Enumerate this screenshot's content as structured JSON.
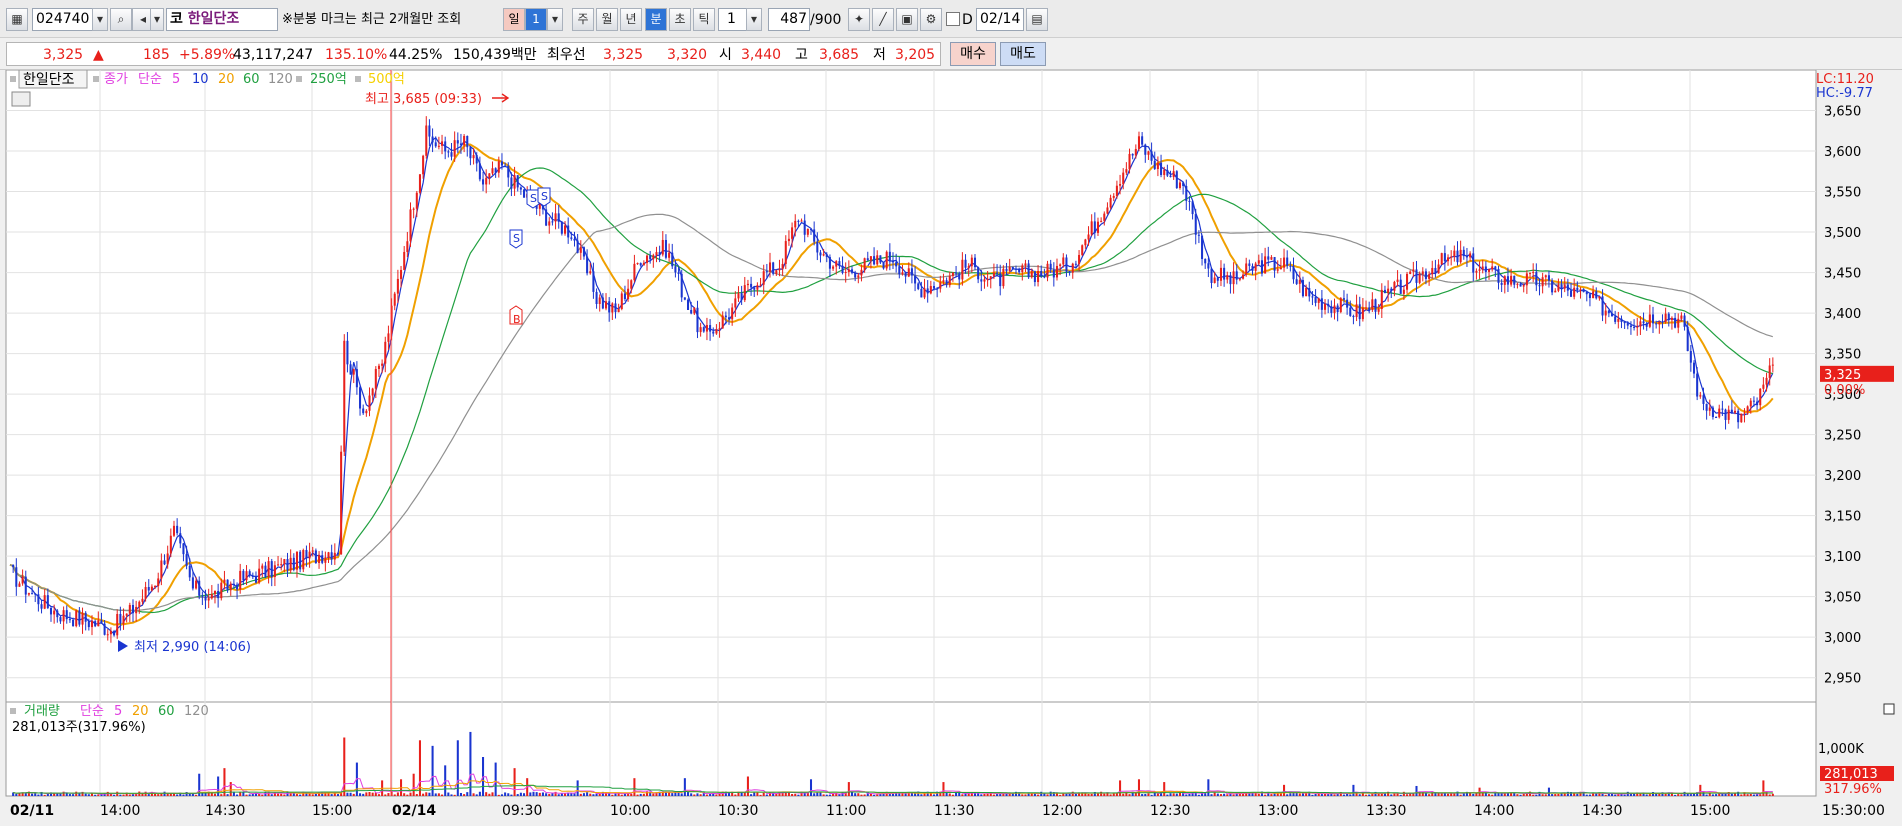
{
  "toolbar": {
    "code": "024740",
    "market_tag": "코",
    "name": "한일단조",
    "notice": "※분봉 마크는 최근 2개월만 조회",
    "period_tabs": [
      {
        "label": "일",
        "active": false
      },
      {
        "label": "주",
        "active": false
      },
      {
        "label": "월",
        "active": false
      },
      {
        "label": "년",
        "active": false
      },
      {
        "label": "분",
        "active": true
      },
      {
        "label": "초",
        "active": false
      },
      {
        "label": "틱",
        "active": false
      }
    ],
    "day_count": "1",
    "interval": "1",
    "count": "487",
    "count_max": "/900",
    "date_flag": "D",
    "date": "02/14"
  },
  "quote": {
    "price": "3,325",
    "change_arrow": "▲",
    "change": "185",
    "change_pct": "+5.89%",
    "volume": "43,117,247",
    "volume_ratio": "135.10%",
    "turnover_pct": "44.25%",
    "amount": "150,439백만",
    "best_label": "최우선",
    "best_ask": "3,325",
    "best_bid": "3,320",
    "open_label": "시",
    "open": "3,440",
    "high_label": "고",
    "high": "3,685",
    "low_label": "저",
    "low": "3,205",
    "buy_label": "매수",
    "sell_label": "매도"
  },
  "colors": {
    "up": "#e8201b",
    "down": "#1a35d0",
    "ma5": "#1a35d0",
    "ma10": "#e040e0",
    "ma20": "#f0a000",
    "ma60": "#20a040",
    "ma120": "#909090",
    "vol5": "#e040e0",
    "vol20": "#f0a000",
    "vol60": "#20a040"
  },
  "chart_data": {
    "type": "candlestick",
    "title": "",
    "legend": {
      "name": "한일단조",
      "field": "종가",
      "method": "단순",
      "periods": [
        "5",
        "10",
        "20",
        "60",
        "120"
      ],
      "amounts": [
        "250억",
        "500억"
      ]
    },
    "y_ticks": [
      "3,650",
      "3,600",
      "3,550",
      "3,500",
      "3,450",
      "3,400",
      "3,350",
      "3,300",
      "3,250",
      "3,200",
      "3,150",
      "3,100",
      "3,050",
      "3,000",
      "2,950"
    ],
    "ylim": [
      2920,
      3700
    ],
    "x_ticks": [
      "02/11",
      "14:00",
      "14:30",
      "15:00",
      "02/14",
      "09:30",
      "10:00",
      "10:30",
      "11:00",
      "11:30",
      "12:00",
      "12:30",
      "13:00",
      "13:30",
      "14:00",
      "14:30",
      "15:00",
      "15:30:00"
    ],
    "high_marker": "최고 3,685 (09:33)",
    "low_marker": "최저 2,990 (14:06)",
    "lc_label": "LC:11.20",
    "hc_label": "HC:-9.77",
    "current_price": "3,325",
    "current_pct": "0.00%",
    "marks": [
      "S",
      "S",
      "S",
      "B"
    ],
    "price_anchors": [
      [
        0,
        3080
      ],
      [
        8,
        3050
      ],
      [
        15,
        3030
      ],
      [
        25,
        3020
      ],
      [
        32,
        3010
      ],
      [
        38,
        3030
      ],
      [
        46,
        3070
      ],
      [
        52,
        3130
      ],
      [
        58,
        3060
      ],
      [
        64,
        3050
      ],
      [
        72,
        3070
      ],
      [
        80,
        3080
      ],
      [
        88,
        3090
      ],
      [
        96,
        3100
      ],
      [
        104,
        3110
      ],
      [
        106,
        3360
      ],
      [
        112,
        3280
      ],
      [
        118,
        3340
      ],
      [
        126,
        3500
      ],
      [
        132,
        3620
      ],
      [
        138,
        3600
      ],
      [
        144,
        3610
      ],
      [
        150,
        3560
      ],
      [
        156,
        3580
      ],
      [
        162,
        3550
      ],
      [
        170,
        3520
      ],
      [
        178,
        3500
      ],
      [
        186,
        3420
      ],
      [
        192,
        3400
      ],
      [
        200,
        3470
      ],
      [
        208,
        3480
      ],
      [
        214,
        3420
      ],
      [
        220,
        3370
      ],
      [
        228,
        3400
      ],
      [
        236,
        3440
      ],
      [
        244,
        3460
      ],
      [
        250,
        3520
      ],
      [
        256,
        3480
      ],
      [
        264,
        3450
      ],
      [
        272,
        3460
      ],
      [
        280,
        3470
      ],
      [
        288,
        3430
      ],
      [
        296,
        3440
      ],
      [
        304,
        3460
      ],
      [
        312,
        3440
      ],
      [
        320,
        3450
      ],
      [
        328,
        3450
      ],
      [
        336,
        3460
      ],
      [
        344,
        3510
      ],
      [
        352,
        3570
      ],
      [
        358,
        3610
      ],
      [
        364,
        3580
      ],
      [
        372,
        3560
      ],
      [
        380,
        3450
      ],
      [
        388,
        3440
      ],
      [
        396,
        3460
      ],
      [
        404,
        3460
      ],
      [
        412,
        3420
      ],
      [
        420,
        3410
      ],
      [
        428,
        3400
      ],
      [
        436,
        3420
      ],
      [
        444,
        3440
      ],
      [
        452,
        3460
      ],
      [
        460,
        3470
      ],
      [
        468,
        3450
      ],
      [
        476,
        3440
      ],
      [
        484,
        3440
      ],
      [
        492,
        3430
      ],
      [
        500,
        3420
      ],
      [
        508,
        3400
      ],
      [
        516,
        3390
      ],
      [
        524,
        3400
      ],
      [
        530,
        3390
      ],
      [
        536,
        3290
      ],
      [
        542,
        3280
      ],
      [
        548,
        3270
      ],
      [
        554,
        3290
      ],
      [
        558,
        3325
      ]
    ],
    "ma_lines": [
      {
        "name": "5",
        "smooth": 3
      },
      {
        "name": "20",
        "smooth": 14
      },
      {
        "name": "60",
        "smooth": 40
      },
      {
        "name": "120",
        "smooth": 80
      }
    ],
    "volume": {
      "label": "거래량",
      "method": "단순",
      "periods": [
        "5",
        "20",
        "60",
        "120"
      ],
      "current": "281,013주(317.96%)",
      "y_tick": "1,000K",
      "ylim": [
        0,
        1400000
      ],
      "current_value": "281,013",
      "current_pct": "317.96%",
      "spikes": [
        [
          60,
          400000
        ],
        [
          66,
          350000
        ],
        [
          68,
          500000
        ],
        [
          70,
          250000
        ],
        [
          106,
          1050000
        ],
        [
          110,
          600000
        ],
        [
          118,
          280000
        ],
        [
          124,
          300000
        ],
        [
          128,
          400000
        ],
        [
          130,
          1000000
        ],
        [
          134,
          900000
        ],
        [
          138,
          550000
        ],
        [
          142,
          1000000
        ],
        [
          146,
          1150000
        ],
        [
          150,
          700000
        ],
        [
          154,
          600000
        ],
        [
          160,
          500000
        ],
        [
          164,
          320000
        ],
        [
          180,
          280000
        ],
        [
          198,
          320000
        ],
        [
          214,
          320000
        ],
        [
          234,
          350000
        ],
        [
          254,
          300000
        ],
        [
          266,
          250000
        ],
        [
          296,
          250000
        ],
        [
          352,
          280000
        ],
        [
          358,
          300000
        ],
        [
          366,
          250000
        ],
        [
          380,
          300000
        ],
        [
          404,
          200000
        ],
        [
          426,
          200000
        ],
        [
          446,
          180000
        ],
        [
          466,
          150000
        ],
        [
          488,
          150000
        ],
        [
          536,
          200000
        ],
        [
          556,
          280000
        ]
      ]
    }
  }
}
